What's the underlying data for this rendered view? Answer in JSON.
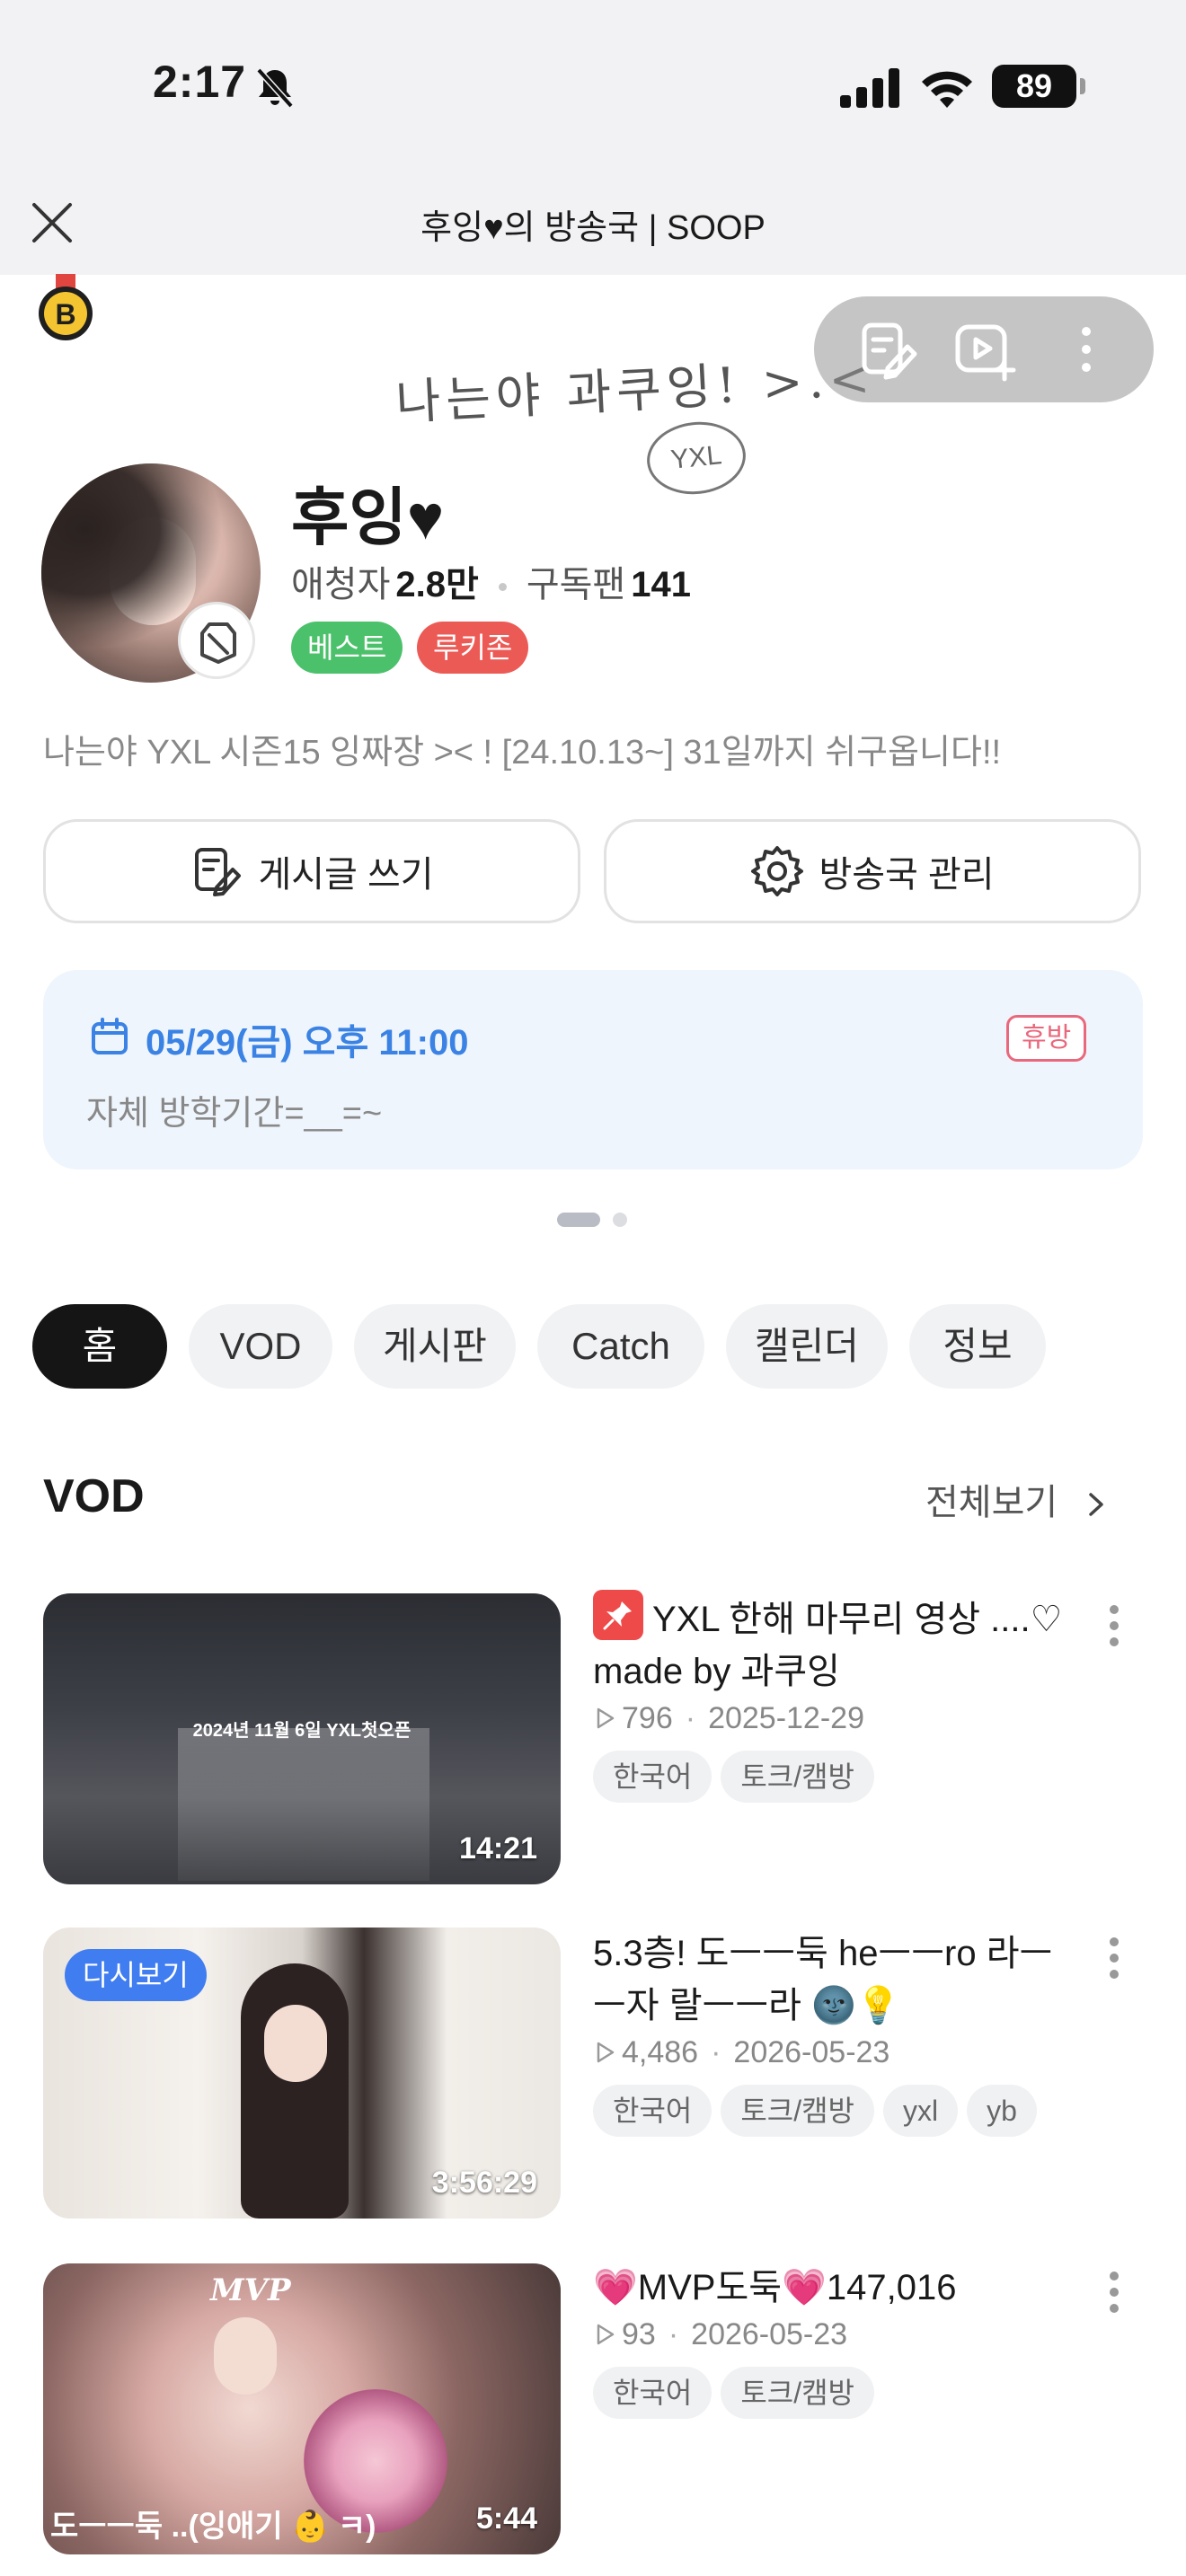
{
  "status_bar": {
    "time": "2:17",
    "battery": "89"
  },
  "browser": {
    "title": "후잉♥의 방송국 | SOOP"
  },
  "banner": {
    "handwriting": "나는야 과쿠잉! >.<",
    "yxl_bubble": "YXL"
  },
  "profile": {
    "name": "후잉♥",
    "viewers_label": "애청자",
    "viewers_value": "2.8만",
    "subscribers_label": "구독팬",
    "subscribers_value": "141",
    "badges": [
      "베스트",
      "루키존"
    ],
    "description": "나는야 YXL 시즌15 잉짜장 >< ! [24.10.13~] 31일까지 쉬구옵니다!!"
  },
  "actions": {
    "write_post": "게시글 쓰기",
    "manage_station": "방송국 관리"
  },
  "schedule": {
    "date": "05/29(금) 오후 11:00",
    "status": "휴방",
    "text": "자체 방학기간=__=~"
  },
  "tabs": [
    "홈",
    "VOD",
    "게시판",
    "Catch",
    "캘린더",
    "정보"
  ],
  "vod_section": {
    "title": "VOD",
    "view_all": "전체보기",
    "items": [
      {
        "title": "YXL 한해 마무리 영상 ....♡ made by 과쿠잉",
        "pinned": true,
        "views": "796",
        "date": "2025-12-29",
        "duration": "14:21",
        "tags": [
          "한국어",
          "토크/캠방"
        ],
        "thumb_text": "2024년 11월 6일 YXL첫오픈"
      },
      {
        "title": "5.3층! 도ㅡㅡ둑 heㅡㅡro 라ㅡㅡ자 랄ㅡㅡ라 🌚💡",
        "pinned": false,
        "replay_badge": "다시보기",
        "views": "4,486",
        "date": "2026-05-23",
        "duration": "3:56:29",
        "tags": [
          "한국어",
          "토크/캠방",
          "yxl",
          "yb"
        ]
      },
      {
        "title": "💗MVP도둑💗147,016",
        "pinned": false,
        "views": "93",
        "date": "2026-05-23",
        "duration": "5:44",
        "tags": [
          "한국어",
          "토크/캠방"
        ],
        "thumb_mark": "MVP",
        "thumb_caption": "도ㅡㅡ둑 ..(잉애기 👶 ㅋ)"
      }
    ]
  },
  "colors": {
    "accent_blue": "#3a82e4",
    "best_green": "#4cc16b",
    "rookie_red": "#ec5a56",
    "rest_pink": "#e9687c",
    "pin_red": "#ef4a4a",
    "replay_blue": "#3f7df0"
  },
  "icons": [
    "bell-off-icon",
    "signal-icon",
    "wifi-icon",
    "close-icon",
    "medal-icon",
    "edit-post-icon",
    "add-video-icon",
    "more-vertical-icon",
    "share-badge-icon",
    "gear-icon",
    "calendar-icon",
    "chevron-right-icon",
    "pin-icon",
    "play-icon"
  ]
}
